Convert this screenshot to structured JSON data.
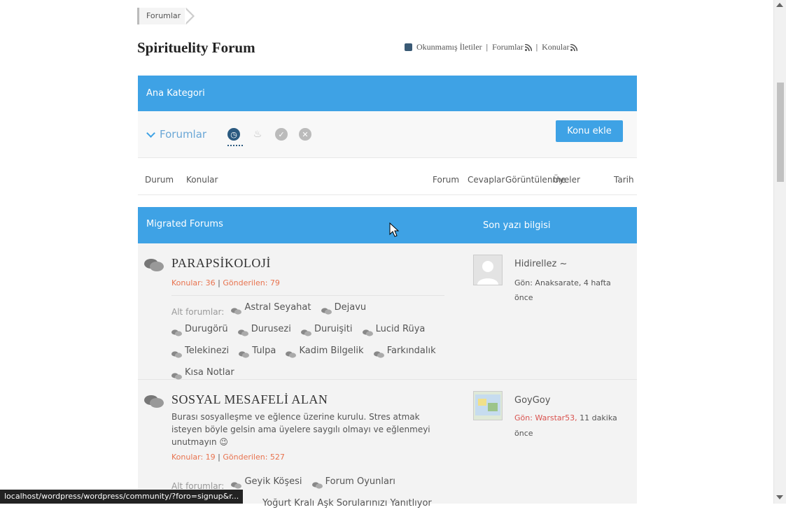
{
  "breadcrumb": {
    "items": [
      "Forumlar"
    ]
  },
  "page": {
    "title": "Spirituelity Forum"
  },
  "toplinks": {
    "unread": "Okunmamış İletiler",
    "separator": "|",
    "forums": "Forumlar",
    "topics": "Konular"
  },
  "category": {
    "label": "Ana Kategori"
  },
  "toolbar": {
    "forums_label": "Forumlar",
    "add_topic": "Konu ekle"
  },
  "table_header": {
    "columns": [
      "Durum",
      "Konular",
      "Forum",
      "Cevaplar",
      "Görüntülenme",
      "Üyeler",
      "Tarih"
    ]
  },
  "section": {
    "title": "Migrated Forums",
    "last_post_header": "Son yazı bilgisi"
  },
  "forums": [
    {
      "title": "PARAPSİKOLOJİ",
      "topics": "Konular: 36",
      "posts": "Gönderilen: 79",
      "description": "",
      "subforums_label": "Alt forumlar:",
      "subforums": [
        "Astral Seyahat",
        "Dejavu",
        "Durugörü",
        "Durusezi",
        "Duruişiti",
        "Lucid Rüya",
        "Telekinezi",
        "Tulpa",
        "Kadim Bilgelik",
        "Farkındalık",
        "Kısa Notlar"
      ],
      "last_user": "Hidirellez ~",
      "last_line": "Gön: Anaksarate, 4 hafta",
      "last_line2": "önce"
    },
    {
      "title": "SOSYAL MESAFELİ ALAN",
      "topics": "Konular: 19",
      "posts": "Gönderilen: 527",
      "description": "Burası sosyalleşme ve eğlence üzerine kurulu. Stres atmak isteyen böyle gelsin ama üyelere saygılı olmayı ve eğlenmeyi unutmayın 😉",
      "subforums_label": "Alt forumlar:",
      "subforums": [
        "Geyik Köşesi",
        "Forum Oyunları"
      ],
      "last_user": "GoyGoy",
      "last_line": "Gön: Warstar53,",
      "last_line_suffix": "11 dakika",
      "last_line2": "önce"
    }
  ],
  "status_url": "localhost/wordpress/wordpress/community/?foro=signup&r...",
  "cutoff_text": "Yoğurt Kralı Aşk Soruları",
  "cutoff_text2": "nızı Yanıtlıyor",
  "colors": {
    "accent_blue": "#3ea2e5",
    "link_red": "#e8734f"
  }
}
